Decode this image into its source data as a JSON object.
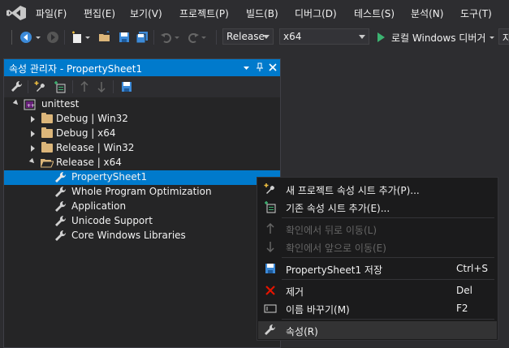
{
  "menubar": {
    "items": [
      "파일(F)",
      "편집(E)",
      "보기(V)",
      "프로젝트(P)",
      "빌드(B)",
      "디버그(D)",
      "테스트(S)",
      "분석(N)",
      "도구(T)"
    ]
  },
  "toolbar": {
    "config": "Release",
    "platform": "x64",
    "debug_target": "로컬 Windows 디버거",
    "overflow": "자"
  },
  "panel": {
    "title": "속성 관리자 - PropertySheet1"
  },
  "tree": {
    "root": "unittest",
    "configs": [
      "Debug | Win32",
      "Debug | x64",
      "Release | Win32",
      "Release | x64"
    ],
    "sheets": [
      "PropertySheet1",
      "Whole Program Optimization",
      "Application",
      "Unicode Support",
      "Core Windows Libraries"
    ]
  },
  "context_menu": {
    "add_new": "새 프로젝트 속성 시트 추가(P)...",
    "add_existing": "기존 속성 시트 추가(E)...",
    "move_up": "확인에서 뒤로 이동(L)",
    "move_down": "확인에서 앞으로 이동(E)",
    "save": "PropertySheet1 저장",
    "save_shortcut": "Ctrl+S",
    "remove": "제거",
    "remove_shortcut": "Del",
    "rename": "이름 바꾸기(M)",
    "rename_shortcut": "F2",
    "properties": "속성(R)"
  },
  "colors": {
    "accent": "#007acc",
    "background": "#2d2d30",
    "panel": "#252526",
    "menu": "#1b1b1c"
  }
}
